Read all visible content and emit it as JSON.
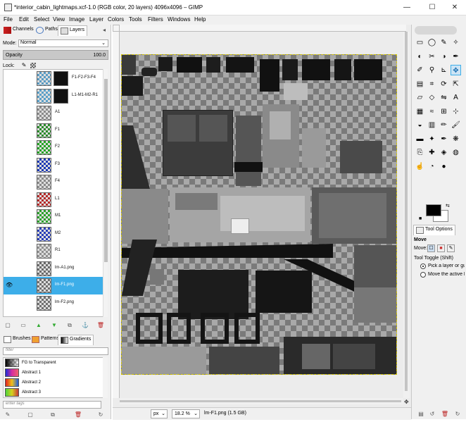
{
  "window": {
    "title": "*interior_cabin_lightmaps.xcf-1.0 (RGB color, 20 layers) 4096x4096 – GIMP",
    "min_glyph": "—",
    "max_glyph": "☐",
    "close_glyph": "✕"
  },
  "menu": [
    "File",
    "Edit",
    "Select",
    "View",
    "Image",
    "Layer",
    "Colors",
    "Tools",
    "Filters",
    "Windows",
    "Help"
  ],
  "layers_panel": {
    "tabs": [
      "Channels",
      "Paths",
      "Layers"
    ],
    "mode_label": "Mode:",
    "mode_value": "Normal",
    "opacity_label": "Opacity",
    "opacity_value": "100.0",
    "lock_label": "Lock:",
    "layers": [
      {
        "name": "F1-F2-F3-F4",
        "thumb": "#5a9bc3",
        "has_mask": true,
        "selected": false,
        "visible": false
      },
      {
        "name": "L1-M1-M2-R1",
        "thumb": "#5aa0c8",
        "has_mask": true,
        "selected": false,
        "visible": false
      },
      {
        "name": "A1",
        "thumb": "#8a8a8a",
        "has_mask": false,
        "selected": false,
        "visible": false
      },
      {
        "name": "F1",
        "thumb": "#2b8a2b",
        "has_mask": false,
        "selected": false,
        "visible": false
      },
      {
        "name": "F2",
        "thumb": "#25a325",
        "has_mask": false,
        "selected": false,
        "visible": false
      },
      {
        "name": "F3",
        "thumb": "#1d3ab5",
        "has_mask": false,
        "selected": false,
        "visible": false
      },
      {
        "name": "F4",
        "thumb": "#8a8a8a",
        "has_mask": false,
        "selected": false,
        "visible": false
      },
      {
        "name": "L1",
        "thumb": "#b52a2a",
        "has_mask": false,
        "selected": false,
        "visible": false
      },
      {
        "name": "M1",
        "thumb": "#2ba12b",
        "has_mask": false,
        "selected": false,
        "visible": false
      },
      {
        "name": "M2",
        "thumb": "#2a3fb8",
        "has_mask": false,
        "selected": false,
        "visible": false
      },
      {
        "name": "R1",
        "thumb": "#909090",
        "has_mask": false,
        "selected": false,
        "visible": false
      },
      {
        "name": "lm-A1.png",
        "thumb": "#6a6a6a",
        "has_mask": false,
        "selected": false,
        "visible": false
      },
      {
        "name": "lm-F1.png",
        "thumb": "#707070",
        "has_mask": false,
        "selected": true,
        "visible": true
      },
      {
        "name": "lm-F2.png",
        "thumb": "#6f6f6f",
        "has_mask": false,
        "selected": false,
        "visible": false
      }
    ]
  },
  "resources_panel": {
    "tabs": [
      "Brushes",
      "Patterns",
      "Gradients"
    ],
    "filter_placeholder": "filter",
    "gradients": [
      {
        "name": "FG to Transparent",
        "css": "linear-gradient(90deg,#000,rgba(0,0,0,0)), repeating-conic-gradient(#bbb 0 25%, #fff 0 50%) 0 0/6px 6px"
      },
      {
        "name": "Abstract 1",
        "css": "linear-gradient(90deg,#1a2bd6,#d62fa0,#f0606b)"
      },
      {
        "name": "Abstract 2",
        "css": "linear-gradient(90deg,#e01f1f,#f0c21a,#1f5fe0)"
      },
      {
        "name": "Abstract 3",
        "css": "linear-gradient(90deg,#4bd13b,#d6d21f,#c83838)"
      }
    ],
    "tags_placeholder": "enter tags"
  },
  "status": {
    "unit": "px",
    "zoom": "18.2 %",
    "info": "lm-F1.png (1.5 GB)"
  },
  "tool_options": {
    "tab": "Tool Options",
    "tool_name": "Move",
    "move_label": "Move:",
    "toggle_label": "Tool Toggle  (Shift)",
    "option_1": "Pick a layer or guide",
    "option_2": "Move the active layer"
  },
  "colors": {
    "accent": "#3daee9",
    "selection_border": "#d4c400",
    "checker_dark": "#7a7a7a",
    "checker_light": "#a9a9a9"
  }
}
